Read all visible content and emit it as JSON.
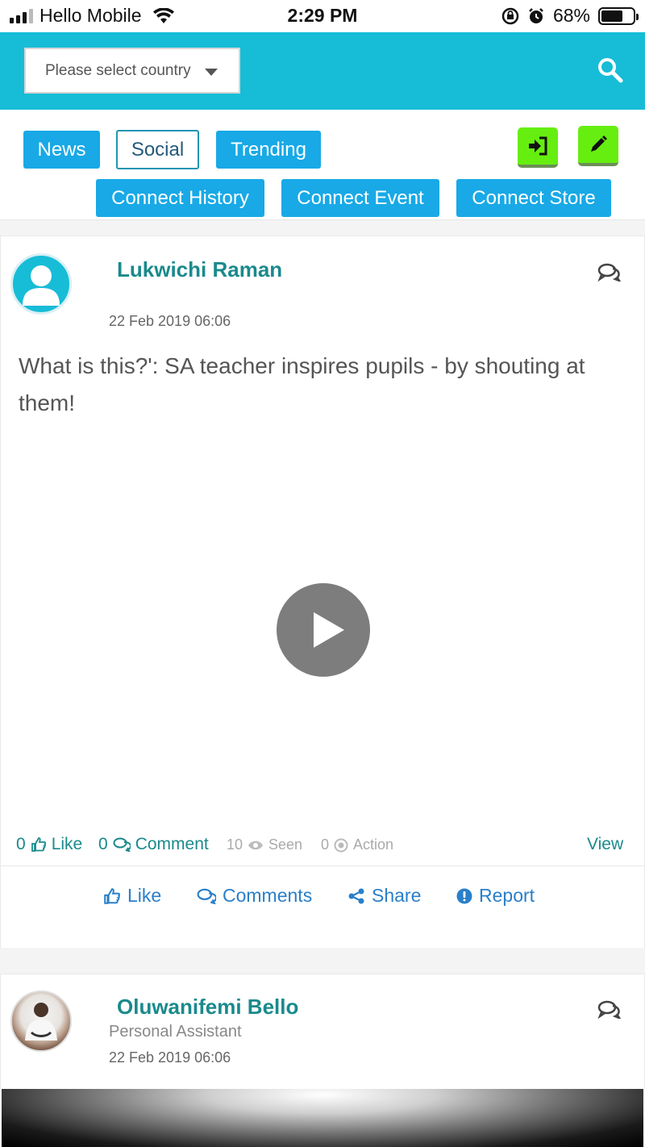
{
  "status_bar": {
    "carrier": "Hello Mobile",
    "time": "2:29 PM",
    "battery_percent": "68%",
    "battery_level": 0.68,
    "icons": [
      "signal-icon",
      "wifi-icon",
      "rotation-lock-icon",
      "alarm-icon",
      "battery-icon"
    ]
  },
  "header": {
    "country_placeholder": "Please select country",
    "search_icon": "search-icon",
    "color": "#17bcd7"
  },
  "nav": {
    "tabs": [
      {
        "label": "News",
        "active": false
      },
      {
        "label": "Social",
        "active": true
      },
      {
        "label": "Trending",
        "active": false
      }
    ],
    "connect_tabs": [
      {
        "label": "Connect History"
      },
      {
        "label": "Connect Event"
      },
      {
        "label": "Connect Store"
      }
    ],
    "login_icon": "sign-in-icon",
    "compose_icon": "pencil-icon",
    "accent": "#18a9e6",
    "green": "#66ee11"
  },
  "posts": [
    {
      "author": "Lukwichi Raman",
      "subtitle": "",
      "timestamp": "22 Feb 2019 06:06",
      "text": "What is this?': SA teacher inspires pupils - by shouting at them!",
      "stats": {
        "likes_count": "0",
        "likes_label": "Like",
        "comments_count": "0",
        "comments_label": "Comment",
        "seen_count": "10",
        "seen_label": "Seen",
        "action_count": "0",
        "action_label": "Action",
        "view_label": "View"
      },
      "actions": {
        "like": "Like",
        "comments": "Comments",
        "share": "Share",
        "report": "Report"
      }
    },
    {
      "author": "Oluwanifemi Bello",
      "subtitle": "Personal Assistant",
      "timestamp": "22 Feb 2019 06:06"
    }
  ]
}
